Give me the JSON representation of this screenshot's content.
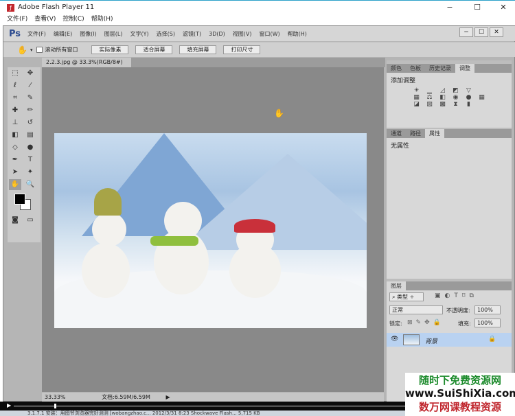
{
  "window": {
    "title": "Adobe Flash Player 11",
    "min": "−",
    "max": "☐",
    "close": "✕"
  },
  "flash_menu": [
    "文件(F)",
    "查看(V)",
    "控制(C)",
    "帮助(H)"
  ],
  "ps": {
    "logo": "Ps",
    "menu": [
      "文件(F)",
      "编辑(E)",
      "图像(I)",
      "图层(L)",
      "文字(Y)",
      "选择(S)",
      "滤镜(T)",
      "3D(D)",
      "视图(V)",
      "窗口(W)",
      "帮助(H)"
    ],
    "window_controls": [
      "−",
      "☐",
      "✕"
    ],
    "options": {
      "scroll_all_label": "滚动所有窗口",
      "buttons": [
        "实际像素",
        "适合屏幕",
        "填充屏幕",
        "打印尺寸"
      ]
    },
    "doc_tab": "2.2.3.jpg @ 33.3%(RGB/8#)",
    "doc_tab_close": "×",
    "status": {
      "zoom": "33.33%",
      "doc": "文档:6.59M/6.59M"
    },
    "panels": {
      "top_tabs": [
        "颜色",
        "色板",
        "历史记录",
        "调整"
      ],
      "adjust_title": "添加调整",
      "mid_tabs": [
        "通道",
        "路径",
        "属性"
      ],
      "properties_text": "无属性",
      "layers_tab": "图层",
      "filter_kind": "类型",
      "blend_mode": "正常",
      "opacity_label": "不透明度:",
      "opacity": "100%",
      "lock_label": "锁定:",
      "fill_label": "填充:",
      "fill": "100%",
      "layer_name": "背景"
    }
  },
  "taskbar_text": "3.1.7.1 安装：用图爷浏览器完好测测 [wobangzhao.c...   2012/3/31 8:23   Shockwave Flash...   5,715 KB",
  "watermark": {
    "line1": "随时下免费资源网",
    "line2": "www.SuiShiXia.com",
    "line3": "数万网课教程资源"
  }
}
